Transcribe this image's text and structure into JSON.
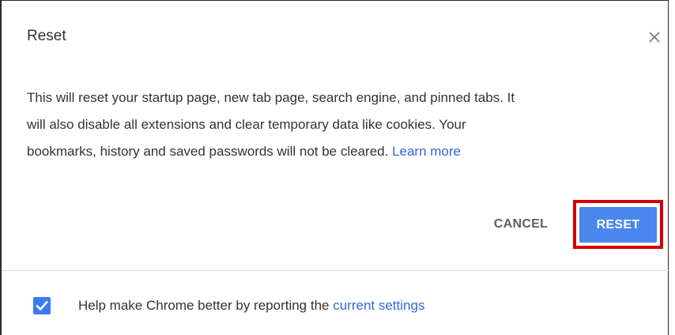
{
  "dialog": {
    "title": "Reset",
    "close_icon": "close-icon",
    "body": {
      "line1": "This will reset your startup page, new tab page, search engine, and pinned tabs. It",
      "line2": "will also disable all extensions and clear temporary data like cookies. Your",
      "line3": "bookmarks, history and saved passwords will not be cleared. ",
      "learn_more": "Learn more"
    },
    "buttons": {
      "cancel": "CANCEL",
      "reset": "RESET"
    },
    "footer": {
      "checkbox_checked": true,
      "text": "Help make Chrome better by reporting the ",
      "link": "current settings"
    }
  },
  "colors": {
    "accent": "#4a87ec",
    "link": "#3367d6",
    "highlight": "#d50000",
    "checkbox": "#3a7bf0"
  }
}
